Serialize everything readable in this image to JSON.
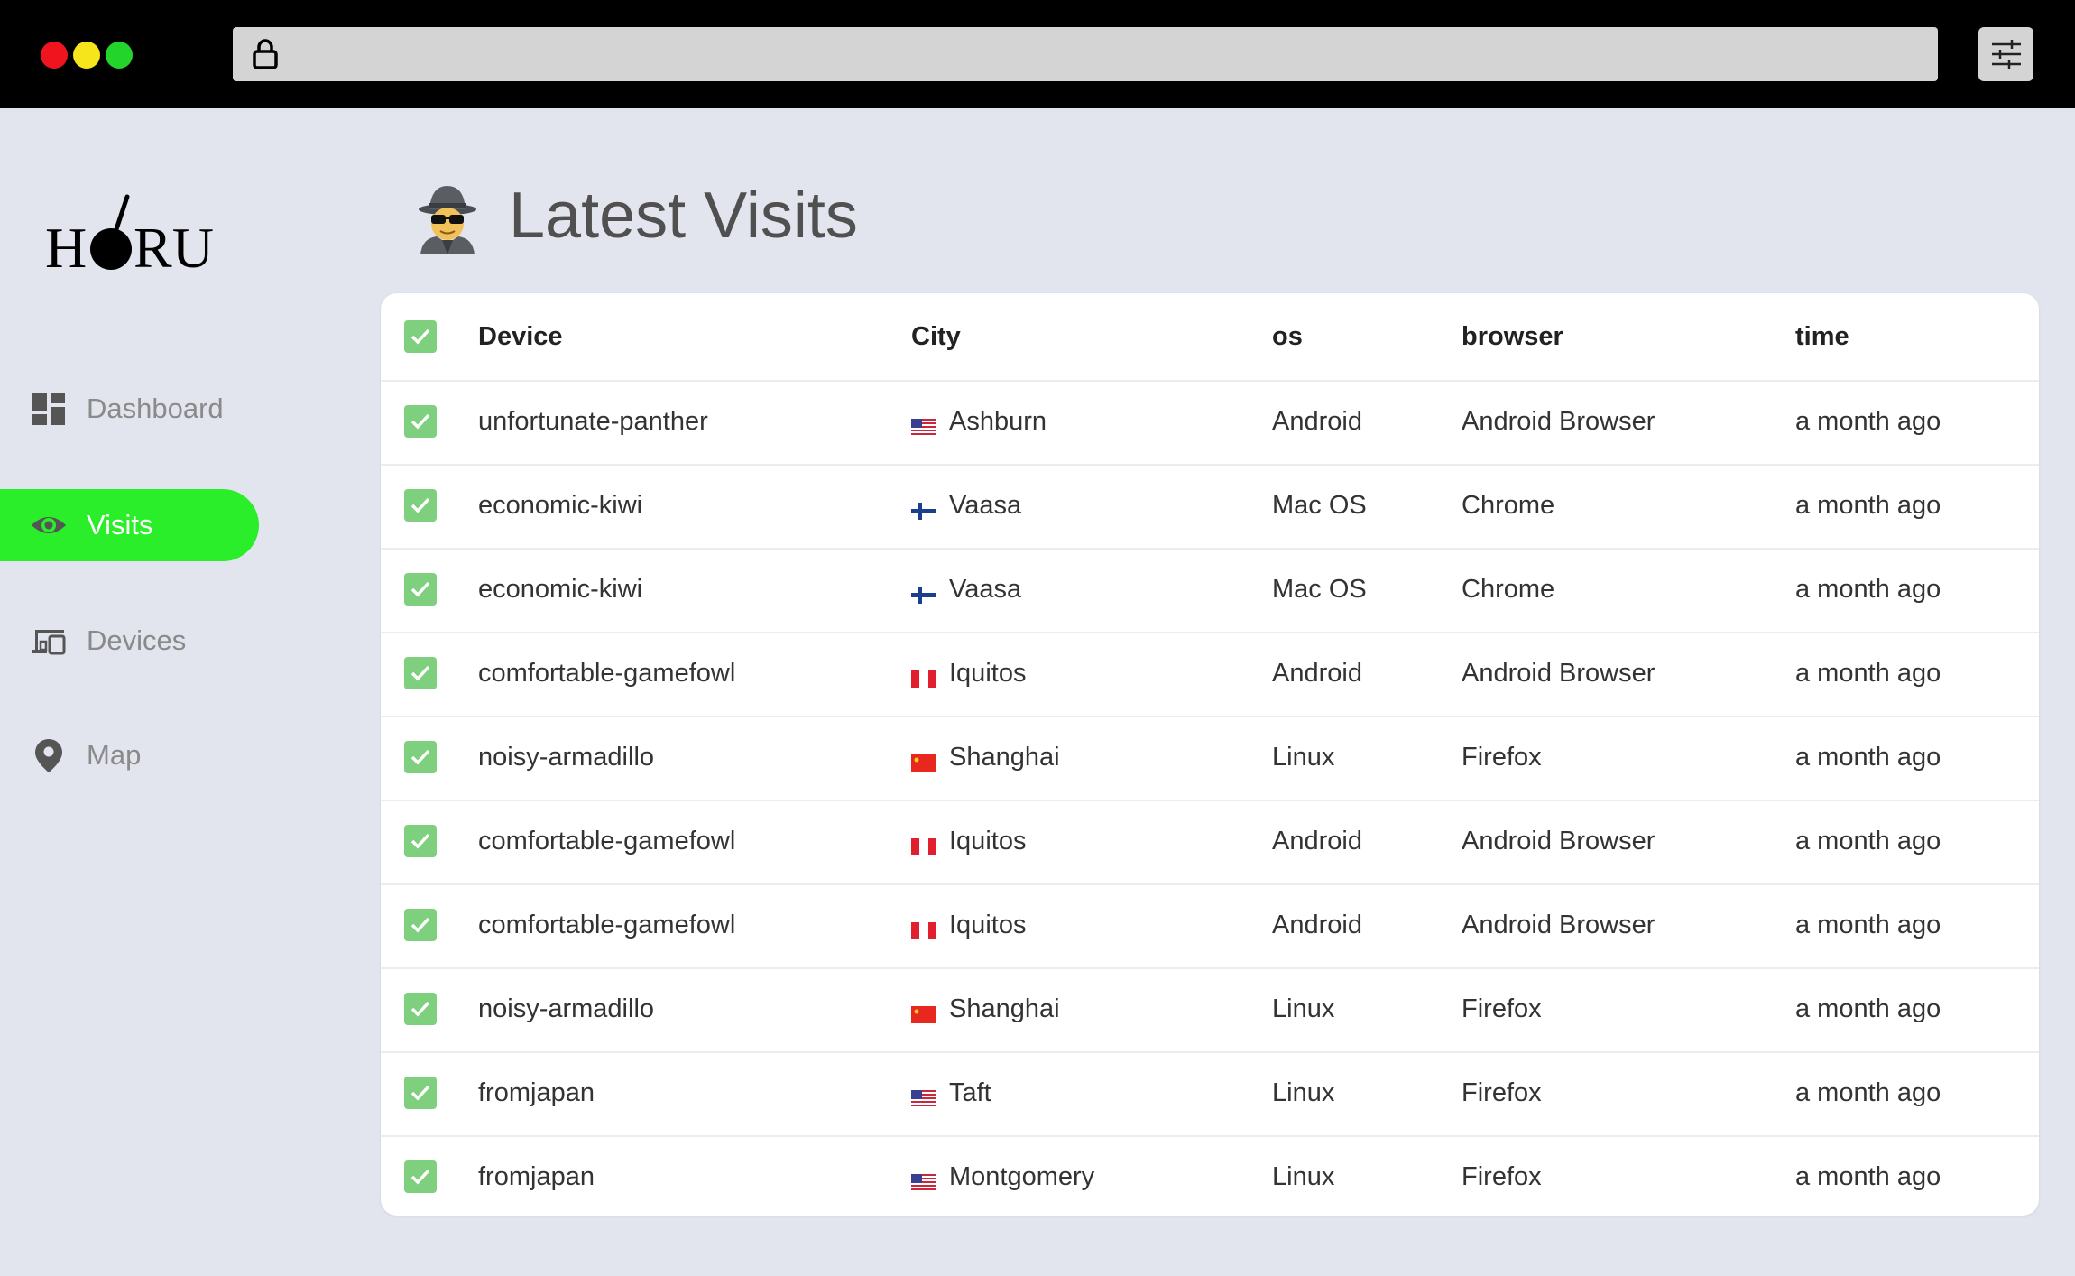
{
  "app": {
    "logo_text": "HORU",
    "page_title": "Latest Visits"
  },
  "sidebar": {
    "items": [
      {
        "label": "Dashboard",
        "icon": "dashboard-icon",
        "active": false
      },
      {
        "label": "Visits",
        "icon": "eye-icon",
        "active": true
      },
      {
        "label": "Devices",
        "icon": "devices-icon",
        "active": false
      },
      {
        "label": "Map",
        "icon": "map-pin-icon",
        "active": false
      }
    ]
  },
  "colors": {
    "accent": "#2aee2a",
    "checkbox": "#7ecf7e",
    "background": "#e3e5ee"
  },
  "table": {
    "headers": {
      "device": "Device",
      "city": "City",
      "os": "os",
      "browser": "browser",
      "time": "time"
    },
    "rows": [
      {
        "device": "unfortunate-panther",
        "flag": "us",
        "city": "Ashburn",
        "os": "Android",
        "browser": "Android Browser",
        "time": "a month ago"
      },
      {
        "device": "economic-kiwi",
        "flag": "fi",
        "city": "Vaasa",
        "os": "Mac OS",
        "browser": "Chrome",
        "time": "a month ago"
      },
      {
        "device": "economic-kiwi",
        "flag": "fi",
        "city": "Vaasa",
        "os": "Mac OS",
        "browser": "Chrome",
        "time": "a month ago"
      },
      {
        "device": "comfortable-gamefowl",
        "flag": "pe",
        "city": "Iquitos",
        "os": "Android",
        "browser": "Android Browser",
        "time": "a month ago"
      },
      {
        "device": "noisy-armadillo",
        "flag": "cn",
        "city": "Shanghai",
        "os": "Linux",
        "browser": "Firefox",
        "time": "a month ago"
      },
      {
        "device": "comfortable-gamefowl",
        "flag": "pe",
        "city": "Iquitos",
        "os": "Android",
        "browser": "Android Browser",
        "time": "a month ago"
      },
      {
        "device": "comfortable-gamefowl",
        "flag": "pe",
        "city": "Iquitos",
        "os": "Android",
        "browser": "Android Browser",
        "time": "a month ago"
      },
      {
        "device": "noisy-armadillo",
        "flag": "cn",
        "city": "Shanghai",
        "os": "Linux",
        "browser": "Firefox",
        "time": "a month ago"
      },
      {
        "device": "fromjapan",
        "flag": "us",
        "city": "Taft",
        "os": "Linux",
        "browser": "Firefox",
        "time": "a month ago"
      },
      {
        "device": "fromjapan",
        "flag": "us",
        "city": "Montgomery",
        "os": "Linux",
        "browser": "Firefox",
        "time": "a month ago"
      }
    ]
  }
}
